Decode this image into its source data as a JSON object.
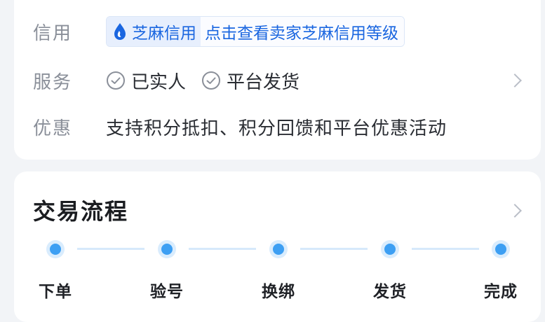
{
  "info": {
    "credit": {
      "label": "信用",
      "brand": "芝麻信用",
      "link": "点击查看卖家芝麻信用等级"
    },
    "service": {
      "label": "服务",
      "items": [
        "已实人",
        "平台发货"
      ]
    },
    "discount": {
      "label": "优惠",
      "text": "支持积分抵扣、积分回馈和平台优惠活动"
    }
  },
  "flow": {
    "title": "交易流程",
    "steps": [
      "下单",
      "验号",
      "换绑",
      "发货",
      "完成"
    ]
  },
  "colors": {
    "accent": "#3d9ff3",
    "link": "#1a66e0",
    "background": "#f2f4f7"
  },
  "icons": {
    "credit": "flame-drop-icon",
    "service": "check-circle-icon",
    "more": "chevron-right-icon"
  }
}
